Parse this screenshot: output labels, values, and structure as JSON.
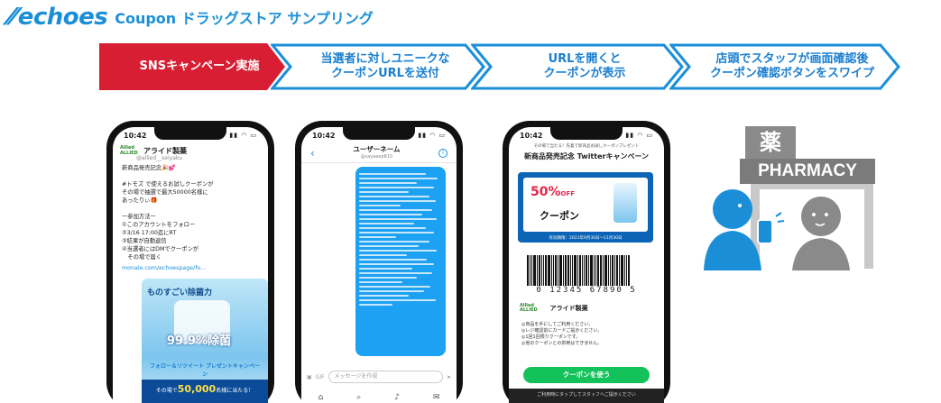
{
  "header": {
    "logo": "echoes",
    "subtitle": "Coupon ドラッグストア サンプリング"
  },
  "steps": [
    {
      "label": "SNSキャンペーン実施"
    },
    {
      "label": "当選者に対しユニークな\nクーポンURLを送付"
    },
    {
      "label": "URLを開くと\nクーポンが表示"
    },
    {
      "label": "店頭でスタッフが画面確認後\nクーポン確認ボタンをスワイプ"
    }
  ],
  "colors": {
    "brand": "#1a8fd8",
    "step_active": "#d81e32",
    "twitter": "#1da1f2",
    "coupon_button": "#13c25a"
  },
  "phone1": {
    "time": "10:42",
    "account_name": "アライド製薬",
    "account_handle": "@allied__seiyaku",
    "tweet_text": "新商品発売記念🎉💕\n\n#トモズ で使えるお試しクーポンが\nその場で抽選で最大50000名様に\nあったりぃ🎁\n\nー参加方法ー\n①このアカウントをフォロー\n②3/16 17:00迄にRT\n③結果が自動返信\n④当選者にはDMでクーポンが\n　その場で届く",
    "tweet_link": "monale.com/echoespage/fo...",
    "media_title": "ものすごい除菌力",
    "media_percent": "99.9%除菌",
    "media_cta": "フォロー＆リツイート プレゼントキャンペーン",
    "media_bottom_prefix": "その場で",
    "media_bottom_count": "50,000",
    "media_bottom_suffix": "名様に当たる！"
  },
  "phone2": {
    "time": "10:42",
    "title": "ユーザーネーム",
    "handle": "@sayaeep810",
    "input_placeholder": "メッセージを作成"
  },
  "phone3": {
    "time": "10:42",
    "header_small": "その場で当たる！先着で新商品お試しクーポンプレゼント",
    "campaign_title": "新商品発売記念 Twitterキャンペーン",
    "off_text": "50%",
    "off_suffix": "OFF",
    "coupon_label": "クーポン",
    "valid_text": "有効期限：2021年9月30日〜11月30日",
    "barcode_number": "0 12345 67890 5",
    "brand_name": "アライド製薬",
    "notes": "◎商品を手にしてご利用ください。\n◎レジ確認前にカードご提示ください。\n◎1回1回限りクーポンです。\n◎他のクーポンとの併用はできません。",
    "use_button": "クーポンを使う",
    "footer": "ご利用時にタップしてスタッフへご提示ください"
  },
  "pharmacy": {
    "kanji": "薬",
    "sign": "PHARMACY"
  }
}
